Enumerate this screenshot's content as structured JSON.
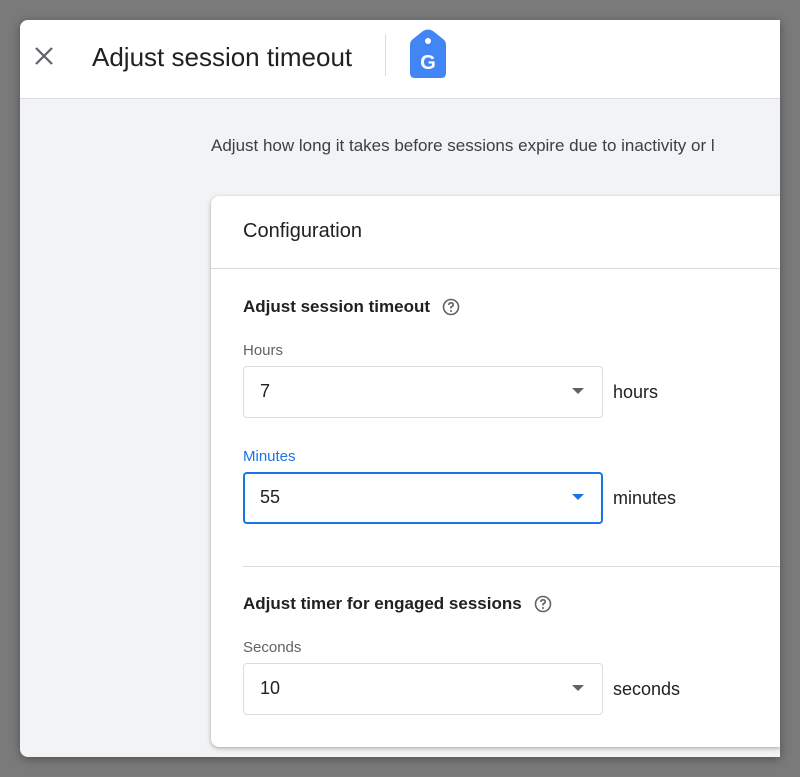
{
  "header": {
    "title": "Adjust session timeout",
    "close_icon": "close-icon",
    "logo_icon": "google-tag-icon",
    "logo_letter": "G"
  },
  "intro_text": "Adjust how long it takes before sessions expire due to inactivity or l",
  "card": {
    "title": "Configuration",
    "session_timeout": {
      "title": "Adjust session timeout",
      "hours": {
        "label": "Hours",
        "value": "7",
        "unit": "hours"
      },
      "minutes": {
        "label": "Minutes",
        "value": "55",
        "unit": "minutes"
      }
    },
    "engaged": {
      "title": "Adjust timer for engaged sessions",
      "seconds": {
        "label": "Seconds",
        "value": "10",
        "unit": "seconds"
      }
    }
  },
  "colors": {
    "accent": "#1a73e8",
    "logo_blue": "#4285f4"
  }
}
